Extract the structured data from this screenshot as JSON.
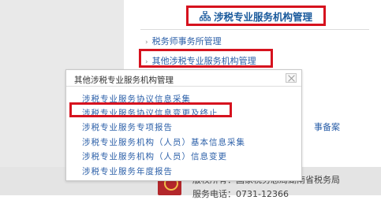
{
  "section": {
    "title": "涉税专业服务机构管理",
    "icon": "org-tree-icon",
    "links": [
      "税务师事务所管理",
      "其他涉税专业服务机构管理"
    ]
  },
  "background_link": "事备案",
  "popup": {
    "title": "其他涉税专业服务机构管理",
    "items": [
      "涉税专业服务协议信息采集",
      "涉税专业服务协议信息变更及终止",
      "涉税专业服务专项报告",
      "涉税专业服务机构（人员）基本信息采集",
      "涉税专业服务机构（人员）信息变更",
      "涉税专业服务年度报告"
    ]
  },
  "footer": {
    "line1": "版权所有：国家税务总局湖南省税务局",
    "line2": "服务电话：0731-12366"
  },
  "colors": {
    "highlight": "#d6121e",
    "link": "#2b5fa8"
  }
}
